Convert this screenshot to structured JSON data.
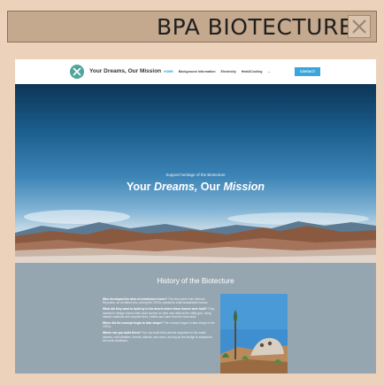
{
  "window": {
    "title": "BPA BIOTECTURE",
    "close_icon": "close-icon"
  },
  "site": {
    "brand": "Your Dreams, Our Mission",
    "logo_icon": "tools-icon",
    "menu": [
      "HOME",
      "Background Information",
      "Electricity",
      "Heat&Cooling",
      "..."
    ],
    "contact_label": "CONTACT"
  },
  "hero": {
    "small_text": "Support heritage of the Biotecture",
    "title_prefix": "Your",
    "title_dreams": "Dreams,",
    "title_middle": "Our",
    "title_mission": "Mission"
  },
  "history": {
    "title": "History of the Biotecture",
    "paragraphs": [
      {
        "q": "Who developed the idea of a biotecture home?",
        "a": "The idea came from Michael Reynolds, an architect who, during the 1970s, wanted to build sustainable homes."
      },
      {
        "q": "What did they want to build by in the desert where these homes were built?",
        "a": "They wanted to design homes that could survive on their own without the utility grid, using natural materials and recycled tires, bottles and cans from the local area."
      },
      {
        "q": "When did the concept begin to take shape?",
        "a": "The concept began to take shape in the 1970s."
      },
      {
        "q": "Where can you build these?",
        "a": "You can build them almost anywhere in the world: deserts, cold climates, forests, islands, and more, as long as the design is adapted to the local conditions."
      }
    ]
  },
  "colors": {
    "page_bg": "#ecd2bb",
    "titlebar_bg": "#c4a98e",
    "accent": "#39a6dc",
    "section_bg": "#96a6b1"
  }
}
